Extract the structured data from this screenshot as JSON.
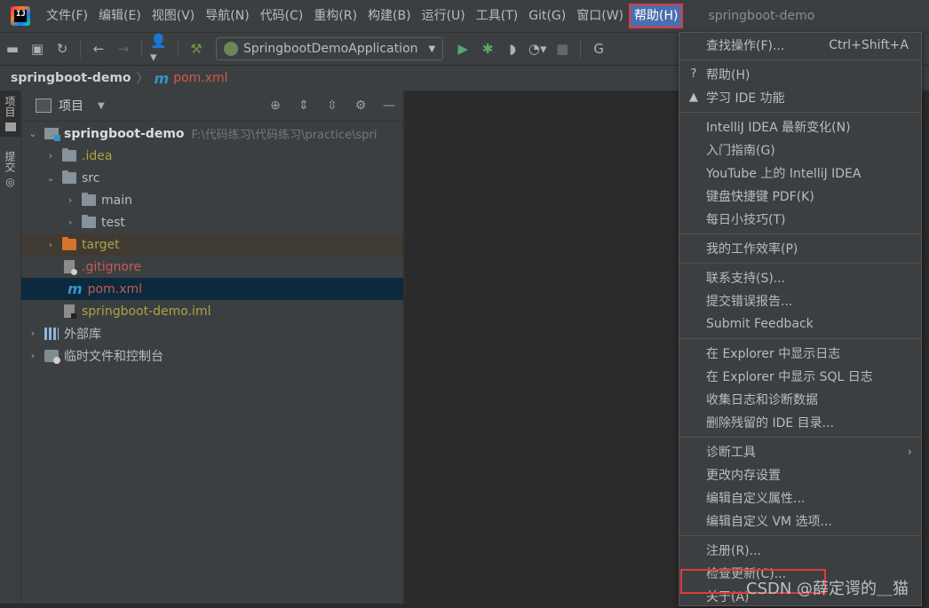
{
  "app": {
    "logo_text": "IJ"
  },
  "menubar": {
    "items": [
      "文件(F)",
      "编辑(E)",
      "视图(V)",
      "导航(N)",
      "代码(C)",
      "重构(R)",
      "构建(B)",
      "运行(U)",
      "工具(T)",
      "Git(G)",
      "窗口(W)",
      "帮助(H)"
    ],
    "window_title": "springboot-demo"
  },
  "toolbar": {
    "run_config": "SpringbootDemoApplication",
    "git_label": "G"
  },
  "breadcrumb": {
    "project": "springboot-demo",
    "file_icon": "m",
    "file": "pom.xml"
  },
  "toolstrip": {
    "tabs": [
      "项目",
      "提交"
    ]
  },
  "project_panel": {
    "title": "项目",
    "tree": [
      {
        "label": "springboot-demo",
        "path": "F:\\代码练习\\代码练习\\practice\\spri"
      },
      {
        "label": ".idea"
      },
      {
        "label": "src"
      },
      {
        "label": "main"
      },
      {
        "label": "test"
      },
      {
        "label": "target"
      },
      {
        "label": ".gitignore"
      },
      {
        "label": "pom.xml",
        "icon_text": "m"
      },
      {
        "label": "springboot-demo.iml"
      },
      {
        "label": "外部库"
      },
      {
        "label": "临时文件和控制台"
      }
    ]
  },
  "help_menu": {
    "items": [
      {
        "label": "查找操作(F)...",
        "shortcut": "Ctrl+Shift+A"
      },
      {
        "label": "帮助(H)",
        "icon": "?"
      },
      {
        "label": "学习 IDE 功能",
        "icon": "🎓"
      },
      {
        "label": "IntelliJ IDEA 最新变化(N)"
      },
      {
        "label": "入门指南(G)"
      },
      {
        "label": "YouTube 上的 IntelliJ IDEA"
      },
      {
        "label": "键盘快捷键 PDF(K)"
      },
      {
        "label": "每日小技巧(T)"
      },
      {
        "label": "我的工作效率(P)"
      },
      {
        "label": "联系支持(S)..."
      },
      {
        "label": "提交错误报告..."
      },
      {
        "label": "Submit Feedback"
      },
      {
        "label": "在 Explorer 中显示日志"
      },
      {
        "label": "在 Explorer 中显示 SQL 日志"
      },
      {
        "label": "收集日志和诊断数据"
      },
      {
        "label": "删除残留的 IDE 目录..."
      },
      {
        "label": "诊断工具",
        "submenu": "›"
      },
      {
        "label": "更改内存设置"
      },
      {
        "label": "编辑自定义属性..."
      },
      {
        "label": "编辑自定义 VM 选项..."
      },
      {
        "label": "注册(R)..."
      },
      {
        "label": "检查更新(C)..."
      },
      {
        "label": "关于(A)"
      }
    ]
  },
  "watermark": "CSDN @薛定谔的＿猫",
  "colors": {
    "menu_highlight": "#4b6eaf",
    "red_box": "#e03a3a",
    "selection": "#0d293e",
    "ignored_olive": "#a9a442"
  }
}
